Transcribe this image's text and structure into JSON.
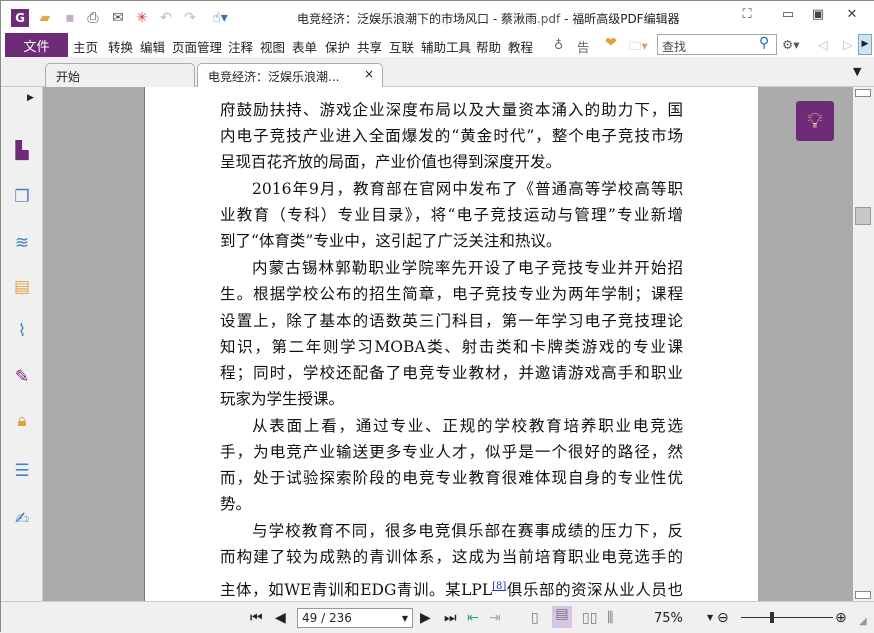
{
  "window": {
    "title_prefix": "电竞经济：泛娱乐浪潮下的市场风口 - 蔡湫雨",
    "title_ext": ".pdf",
    "title_suffix": " - 福昕高级PDF编辑器"
  },
  "menu": {
    "file": "文件",
    "items": [
      "主页",
      "转换",
      "编辑",
      "页面管理",
      "注释",
      "视图",
      "表单",
      "保护",
      "共享",
      "互联",
      "辅助工具",
      "帮助",
      "教程"
    ],
    "tell": "告诉",
    "search_placeholder": "查找"
  },
  "tabs": [
    {
      "label": "开始"
    },
    {
      "label": "电竞经济：泛娱乐浪潮...",
      "close": "×"
    }
  ],
  "document": {
    "lines": [
      {
        "t": "府鼓励扶持、游戏企业深度布局以及大量资本涌入的助力下，国"
      },
      {
        "t": "内电子竞技产业进入全面爆发的“黄金时代”，整个电子竞技市场"
      },
      {
        "t": "呈现百花齐放的局面，产业价值也得到深度开发。",
        "last": true
      },
      {
        "t": "2016年9月，教育部在官网中发布了《普通高等学校高等职",
        "ind": true
      },
      {
        "t": "业教育（专科）专业目录》，将“电子竞技运动与管理”专业新增"
      },
      {
        "t": "到了“体育类”专业中，这引起了广泛关注和热议。",
        "last": true
      },
      {
        "t": "内蒙古锡林郭勒职业学院率先开设了电子竞技专业并开始招",
        "ind": true
      },
      {
        "t": "生。根据学校公布的招生简章，电子竞技专业为两年学制；课程"
      },
      {
        "t": "设置上，除了基本的语数英三门科目，第一年学习电子竞技理论"
      },
      {
        "t": "知识，第二年则学习MOBA类、射击类和卡牌类游戏的专业课"
      },
      {
        "t": "程；同时，学校还配备了电竞专业教材，并邀请游戏高手和职业"
      },
      {
        "t": "玩家为学生授课。",
        "last": true
      },
      {
        "t": "从表面上看，通过专业、正规的学校教育培养职业电竞选",
        "ind": true
      },
      {
        "t": "手，为电竞产业输送更多专业人才，似乎是一个很好的路径，然"
      },
      {
        "t": "而，处于试验探索阶段的电竞专业教育很难体现自身的专业性优"
      },
      {
        "t": "势。",
        "last": true
      },
      {
        "t": "与学校教育不同，很多电竞俱乐部在赛事成绩的压力下，反",
        "ind": true
      },
      {
        "t": "而构建了较为成熟的青训体系，这成为当前培育职业电竞选手的"
      }
    ],
    "last_line": {
      "a": "主体，如WE青训和EDG青训。某LPL",
      "ref": "[8]",
      "b": "俱乐部的资深从业人员也"
    }
  },
  "status": {
    "page": "49 / 236",
    "zoom": "75%"
  },
  "colors": {
    "accent": "#6e2b77"
  }
}
